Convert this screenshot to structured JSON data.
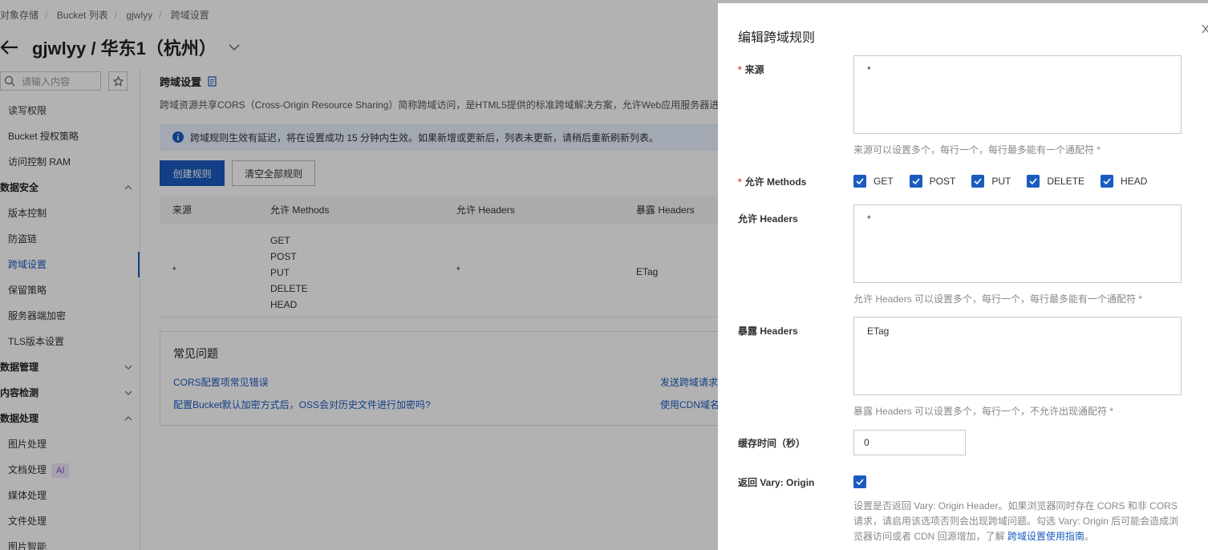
{
  "breadcrumb": [
    "对象存储",
    "Bucket 列表",
    "gjwlyy",
    "跨域设置"
  ],
  "page_title": "gjwlyy / 华东1（杭州）",
  "sidebar": {
    "search_placeholder": "请输入内容",
    "items": [
      {
        "label": "读写权限",
        "type": "item"
      },
      {
        "label": "Bucket 授权策略",
        "type": "item"
      },
      {
        "label": "访问控制 RAM",
        "type": "item"
      },
      {
        "label": "数据安全",
        "type": "group",
        "expanded": true
      },
      {
        "label": "版本控制",
        "type": "item"
      },
      {
        "label": "防盗链",
        "type": "item"
      },
      {
        "label": "跨域设置",
        "type": "item",
        "active": true
      },
      {
        "label": "保留策略",
        "type": "item"
      },
      {
        "label": "服务器端加密",
        "type": "item"
      },
      {
        "label": "TLS版本设置",
        "type": "item"
      },
      {
        "label": "数据管理",
        "type": "group",
        "expanded": false
      },
      {
        "label": "内容检测",
        "type": "group",
        "expanded": false
      },
      {
        "label": "数据处理",
        "type": "group",
        "expanded": true
      },
      {
        "label": "图片处理",
        "type": "item"
      },
      {
        "label": "文档处理",
        "type": "item",
        "badge": "AI"
      },
      {
        "label": "媒体处理",
        "type": "item"
      },
      {
        "label": "文件处理",
        "type": "item"
      },
      {
        "label": "图片智能",
        "type": "item"
      }
    ]
  },
  "main": {
    "section_title": "跨域设置",
    "description": "跨域资源共享CORS（Cross-Origin Resource Sharing）简称跨域访问，是HTML5提供的标准跨域解决方案，允许Web应用服务器进行",
    "notice": "跨域规则生效有延迟，将在设置成功 15 分钟内生效。如果新增或更新后，列表未更新，请稍后重新刷新列表。",
    "create_button": "创建规则",
    "clear_button": "清空全部规则",
    "table": {
      "columns": [
        "来源",
        "允许 Methods",
        "允许 Headers",
        "暴露 Headers"
      ],
      "rows": [
        {
          "origin": "*",
          "methods": [
            "GET",
            "POST",
            "PUT",
            "DELETE",
            "HEAD"
          ],
          "allow_headers": "*",
          "expose_headers": "ETag"
        }
      ]
    },
    "faq": {
      "title": "常见问题",
      "links": [
        "CORS配置项常见错误",
        "配置Bucket默认加密方式后，OSS会对历史文件进行加密吗?",
        "发送跨域请求",
        "使用CDN域名"
      ]
    }
  },
  "drawer": {
    "title": "编辑跨域规则",
    "origin_label": "来源",
    "origin_value": "*",
    "origin_help": "来源可以设置多个，每行一个，每行最多能有一个通配符 *",
    "methods_label": "允许 Methods",
    "methods": [
      {
        "label": "GET",
        "checked": true
      },
      {
        "label": "POST",
        "checked": true
      },
      {
        "label": "PUT",
        "checked": true
      },
      {
        "label": "DELETE",
        "checked": true
      },
      {
        "label": "HEAD",
        "checked": true
      }
    ],
    "allow_headers_label": "允许 Headers",
    "allow_headers_value": "*",
    "allow_headers_help": "允许 Headers 可以设置多个，每行一个，每行最多能有一个通配符 *",
    "expose_headers_label": "暴露 Headers",
    "expose_headers_value": "ETag",
    "expose_headers_help": "暴露 Headers 可以设置多个，每行一个，不允许出现通配符 *",
    "cache_label": "缓存时间（秒）",
    "cache_value": "0",
    "vary_label": "返回 Vary: Origin",
    "vary_checked": true,
    "vary_help": "设置是否返回 Vary: Origin Header。如果浏览器同时存在 CORS 和非 CORS 请求，请启用该选项否则会出现跨域问题。勾选 Vary: Origin 后可能会造成浏览器访问或者 CDN 回源增加，了解",
    "vary_link": "跨域设置使用指南",
    "vary_tail": "。"
  },
  "colors": {
    "primary": "#1a5bbf",
    "notice_bg": "#eaf2ff",
    "required": "#e34d4d",
    "overlay": "rgba(0,0,0,0.30)"
  }
}
